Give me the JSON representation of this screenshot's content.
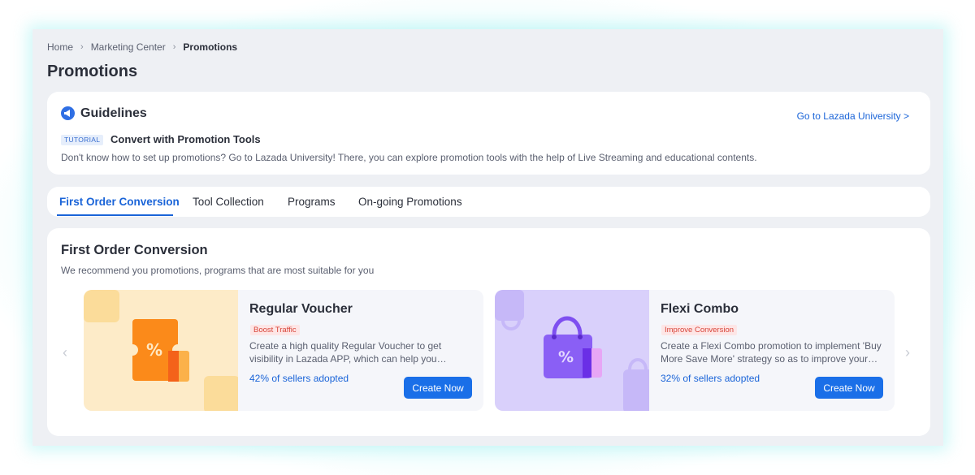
{
  "breadcrumb": {
    "items": [
      "Home",
      "Marketing Center",
      "Promotions"
    ]
  },
  "page_title": "Promotions",
  "guidelines": {
    "title": "Guidelines",
    "link": "Go to Lazada University >",
    "tag": "TUTORIAL",
    "tutorial_title": "Convert with Promotion Tools",
    "description": "Don't know how to set up promotions? Go to Lazada University! There, you can explore promotion tools with the help of Live Streaming and educational contents."
  },
  "tabs": [
    {
      "label": "First Order Conversion",
      "active": true
    },
    {
      "label": "Tool Collection"
    },
    {
      "label": "Programs"
    },
    {
      "label": "On-going Promotions"
    }
  ],
  "section": {
    "title": "First Order Conversion",
    "subtitle": "We recommend you promotions, programs that are most suitable for you"
  },
  "cards": [
    {
      "title": "Regular Voucher",
      "tag": "Boost Traffic",
      "description": "Create a high quality Regular Voucher to get visibility in Lazada APP, which can help you increase exposure.",
      "adoption": "42% of sellers adopted",
      "button": "Create Now",
      "icon": "voucher-icon",
      "accent": "#fdebc8"
    },
    {
      "title": "Flexi Combo",
      "tag": "Improve Conversion",
      "description": "Create a Flexi Combo promotion to implement 'Buy More Save More' strategy so as to improve your conversion.",
      "adoption": "32% of sellers adopted",
      "button": "Create Now",
      "icon": "shopping-bag-icon",
      "accent": "#d9d0fb"
    }
  ],
  "colors": {
    "primary": "#1a64d8",
    "tag_red": "#d8453a",
    "page_bg": "#eef0f4"
  }
}
